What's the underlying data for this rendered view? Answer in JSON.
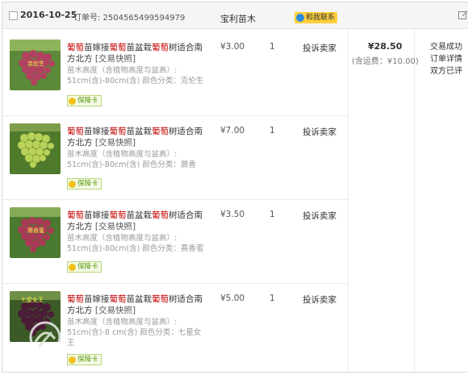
{
  "header": {
    "date": "2016-10-25",
    "order_label": "订单号: 2504565499594979",
    "shop_name": "宝利苗木",
    "contact_label": "和我联系"
  },
  "items": [
    {
      "title_parts": [
        "葡萄",
        "苗嫁接",
        "葡萄",
        "苗盆栽",
        "葡萄",
        "树适合南方北方"
      ],
      "snapshot_label": "[交易快照]",
      "attr_line1": "苗木高度（含植物高度与盆高）:",
      "attr_line2": "51cm(含)-80cm(含)  颜色分类：克伦生",
      "badge": "保障卡",
      "price": "¥3.00",
      "qty": "1",
      "action": "投诉卖家",
      "image_label": "克伦生"
    },
    {
      "title_parts": [
        "葡萄",
        "苗嫁接",
        "葡萄",
        "苗盆栽",
        "葡萄",
        "树适合南方北方"
      ],
      "snapshot_label": "[交易快照]",
      "attr_line1": "苗木高度（含植物高度与盆高）:",
      "attr_line2": "51cm(含)-80cm(含)  颜色分类：晨香",
      "badge": "保障卡",
      "price": "¥7.00",
      "qty": "1",
      "action": "投诉卖家",
      "image_label": ""
    },
    {
      "title_parts": [
        "葡萄",
        "苗嫁接",
        "葡萄",
        "苗盆栽",
        "葡萄",
        "树适合南方北方"
      ],
      "snapshot_label": "[交易快照]",
      "attr_line1": "苗木高度（含植物高度与盆高）:",
      "attr_line2": "51cm(含)-80cm(含)  颜色分类：赛香蜜",
      "badge": "保障卡",
      "price": "¥3.50",
      "qty": "1",
      "action": "投诉卖家",
      "image_label": "赛香蜜"
    },
    {
      "title_parts": [
        "葡萄",
        "苗嫁接",
        "葡萄",
        "苗盆栽",
        "葡萄",
        "树适合南方北方"
      ],
      "snapshot_label": "[交易快照]",
      "attr_line1": "苗木高度（含植物高度与盆高）:",
      "attr_line2": "51cm(含)-8 cm(含)  颜色分类：七星女王",
      "badge": "保障卡",
      "price": "¥5.00",
      "qty": "1",
      "action": "投诉卖家",
      "image_label": "七星女王"
    }
  ],
  "summary": {
    "total": "¥28.50",
    "shipping": "(含运费：¥10.00)",
    "status_lines": [
      "交易成功",
      "订单详情",
      "双方已评"
    ]
  },
  "colors": {
    "highlight": "#c40000",
    "header_bg": "#f5f5f5",
    "contact_bg": "#ffcf3d",
    "badge_text": "#5e9a12"
  }
}
